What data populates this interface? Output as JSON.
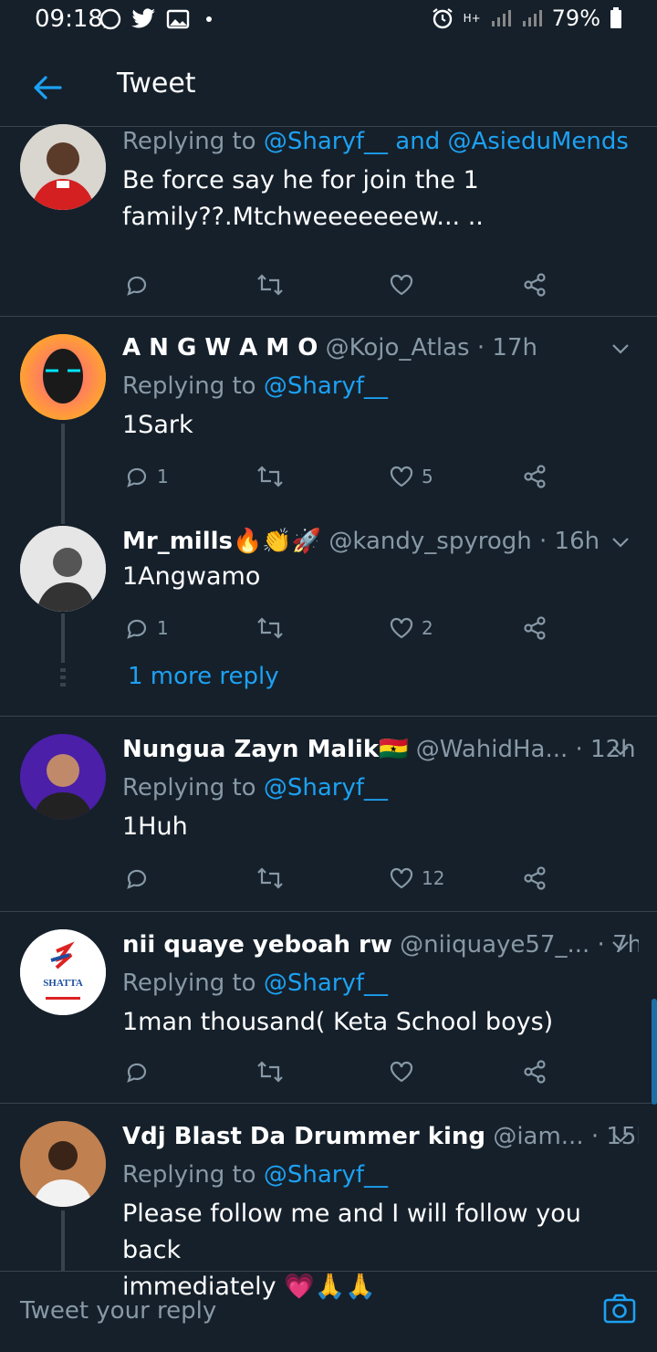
{
  "status": {
    "time": "09:18",
    "battery": "79%",
    "data": "H+"
  },
  "appbar": {
    "title": "Tweet"
  },
  "tweets": [
    {
      "reply_prefix": "Replying to",
      "mentions": [
        "@Sharyf__",
        "@AsieduMends"
      ],
      "connector": "and",
      "text": "Be force say he for join the 1\nfamily??.Mtchweeeeeeew... ..",
      "counts": {
        "reply": "",
        "retweet": "",
        "like": ""
      }
    },
    {
      "name": "A N G W A M O",
      "handle": "@Kojo_Atlas",
      "time": "17h",
      "reply_prefix": "Replying to",
      "mentions": [
        "@Sharyf__"
      ],
      "text": "1Sark",
      "counts": {
        "reply": "1",
        "retweet": "",
        "like": "5"
      }
    },
    {
      "name": "Mr_mills🔥👏🚀",
      "handle": "@kandy_spyrogh",
      "time": "16h",
      "text": "1Angwamo",
      "counts": {
        "reply": "1",
        "retweet": "",
        "like": "2"
      }
    },
    {
      "name": "Nungua Zayn Malik🇬🇭",
      "handle": "@WahidHa...",
      "time": "12h",
      "reply_prefix": "Replying to",
      "mentions": [
        "@Sharyf__"
      ],
      "text": "1Huh",
      "counts": {
        "reply": "",
        "retweet": "",
        "like": "12"
      }
    },
    {
      "name": "nii quaye yeboah rw",
      "handle": "@niiquaye57_...",
      "time": "7h",
      "reply_prefix": "Replying to",
      "mentions": [
        "@Sharyf__"
      ],
      "text": "1man thousand( Keta School boys)",
      "counts": {
        "reply": "",
        "retweet": "",
        "like": ""
      },
      "avatar_label": "SHATTA"
    },
    {
      "name": "Vdj Blast Da Drummer king",
      "handle": "@iam...",
      "time": "15h",
      "reply_prefix": "Replying to",
      "mentions": [
        "@Sharyf__"
      ],
      "text": "Please follow me and I will follow you back\nimmediately 💗🙏🙏"
    }
  ],
  "more_reply": "1 more reply",
  "composer": {
    "placeholder": "Tweet your reply"
  },
  "colors": {
    "bg": "#15202b",
    "accent": "#1da1f2",
    "muted": "#8899a6",
    "divider": "#38444d"
  }
}
